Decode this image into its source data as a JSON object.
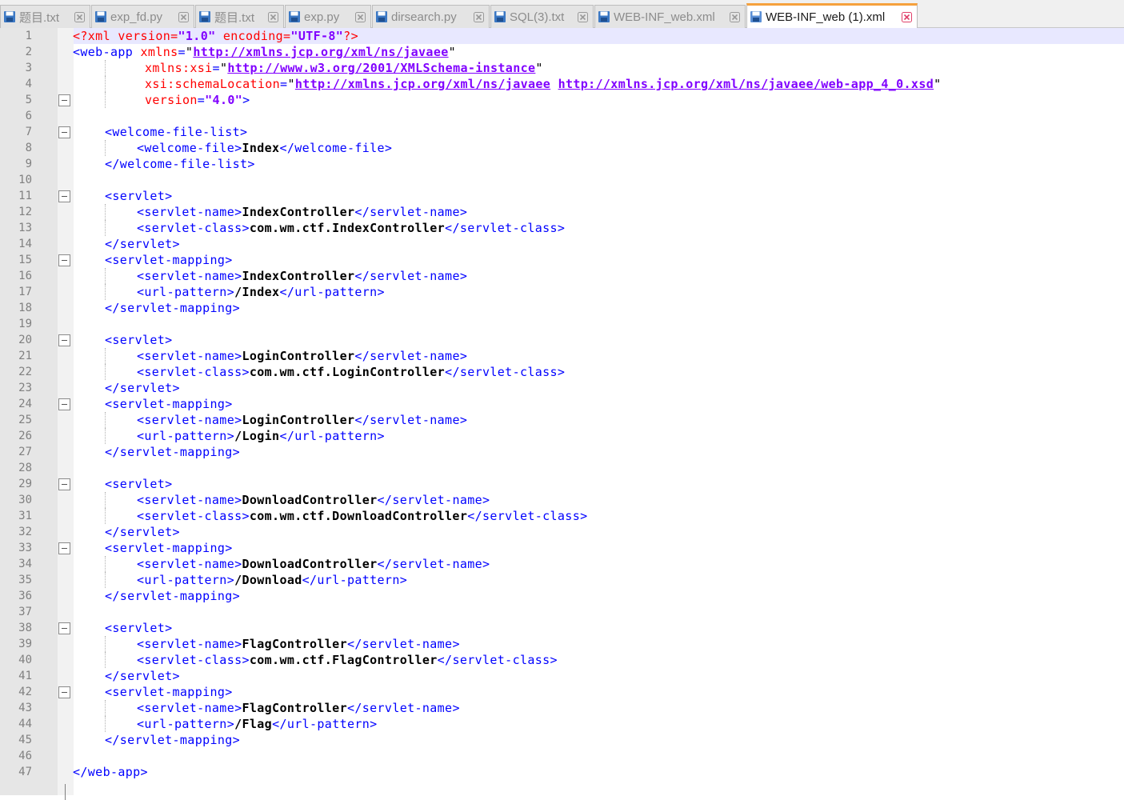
{
  "tabs": [
    {
      "label": "题目.txt",
      "active": false
    },
    {
      "label": "exp_fd.py",
      "active": false
    },
    {
      "label": "题目.txt",
      "active": false
    },
    {
      "label": "exp.py",
      "active": false
    },
    {
      "label": "dirsearch.py",
      "active": false
    },
    {
      "label": "SQL(3).txt",
      "active": false
    },
    {
      "label": "WEB-INF_web.xml",
      "active": false
    },
    {
      "label": "WEB-INF_web (1).xml",
      "active": true
    }
  ],
  "icons": {
    "tab_save": "floppy-save-icon",
    "tab_close": "close-icon",
    "fold": "fold-minus-icon"
  },
  "colors": {
    "tag": "#0000ff",
    "attr": "#ff0000",
    "string": "#8000ff",
    "text": "#000000",
    "active_tab_accent": "#f5a13c",
    "current_line": "#e8e8ff"
  },
  "editor": {
    "current_line": 1,
    "fold_lines": [
      5,
      7,
      11,
      15,
      20,
      24,
      29,
      33,
      38,
      42
    ],
    "lines": [
      {
        "n": "1",
        "indent": 0,
        "parts": [
          [
            "pi",
            "<?xml "
          ],
          [
            "attr",
            "version"
          ],
          [
            "pi",
            "="
          ],
          [
            "str",
            "\"1.0\""
          ],
          [
            "pi",
            " encoding"
          ],
          [
            "pi",
            "="
          ],
          [
            "str",
            "\"UTF-8\""
          ],
          [
            "pi",
            "?>"
          ]
        ]
      },
      {
        "n": "2",
        "indent": 0,
        "parts": [
          [
            "tag",
            "<web-app "
          ],
          [
            "attr",
            "xmlns"
          ],
          [
            "tag",
            "="
          ],
          [
            "quote",
            "\""
          ],
          [
            "url",
            "http://xmlns.jcp.org/xml/ns/javaee"
          ],
          [
            "quote",
            "\""
          ]
        ]
      },
      {
        "n": "3",
        "indent": 9,
        "parts": [
          [
            "attr",
            "xmlns:xsi"
          ],
          [
            "tag",
            "="
          ],
          [
            "quote",
            "\""
          ],
          [
            "url",
            "http://www.w3.org/2001/XMLSchema-instance"
          ],
          [
            "quote",
            "\""
          ]
        ]
      },
      {
        "n": "4",
        "indent": 9,
        "parts": [
          [
            "attr",
            "xsi:schemaLocation"
          ],
          [
            "tag",
            "="
          ],
          [
            "quote",
            "\""
          ],
          [
            "url",
            "http://xmlns.jcp.org/xml/ns/javaee"
          ],
          [
            "tag",
            " "
          ],
          [
            "url",
            "http://xmlns.jcp.org/xml/ns/javaee/web-app_4_0.xsd"
          ],
          [
            "quote",
            "\""
          ]
        ]
      },
      {
        "n": "5",
        "indent": 9,
        "parts": [
          [
            "attr",
            "version"
          ],
          [
            "tag",
            "="
          ],
          [
            "str",
            "\"4.0\""
          ],
          [
            "tag",
            ">"
          ]
        ]
      },
      {
        "n": "6",
        "indent": 0,
        "parts": []
      },
      {
        "n": "7",
        "indent": 4,
        "parts": [
          [
            "tag",
            "<welcome-file-list>"
          ]
        ]
      },
      {
        "n": "8",
        "indent": 8,
        "parts": [
          [
            "tag",
            "<welcome-file>"
          ],
          [
            "txt",
            "Index"
          ],
          [
            "tag",
            "</welcome-file>"
          ]
        ]
      },
      {
        "n": "9",
        "indent": 4,
        "parts": [
          [
            "tag",
            "</welcome-file-list>"
          ]
        ]
      },
      {
        "n": "10",
        "indent": 0,
        "parts": []
      },
      {
        "n": "11",
        "indent": 4,
        "parts": [
          [
            "tag",
            "<servlet>"
          ]
        ]
      },
      {
        "n": "12",
        "indent": 8,
        "parts": [
          [
            "tag",
            "<servlet-name>"
          ],
          [
            "txt",
            "IndexController"
          ],
          [
            "tag",
            "</servlet-name>"
          ]
        ]
      },
      {
        "n": "13",
        "indent": 8,
        "parts": [
          [
            "tag",
            "<servlet-class>"
          ],
          [
            "txt",
            "com.wm.ctf.IndexController"
          ],
          [
            "tag",
            "</servlet-class>"
          ]
        ]
      },
      {
        "n": "14",
        "indent": 4,
        "parts": [
          [
            "tag",
            "</servlet>"
          ]
        ]
      },
      {
        "n": "15",
        "indent": 4,
        "parts": [
          [
            "tag",
            "<servlet-mapping>"
          ]
        ]
      },
      {
        "n": "16",
        "indent": 8,
        "parts": [
          [
            "tag",
            "<servlet-name>"
          ],
          [
            "txt",
            "IndexController"
          ],
          [
            "tag",
            "</servlet-name>"
          ]
        ]
      },
      {
        "n": "17",
        "indent": 8,
        "parts": [
          [
            "tag",
            "<url-pattern>"
          ],
          [
            "txt",
            "/Index"
          ],
          [
            "tag",
            "</url-pattern>"
          ]
        ]
      },
      {
        "n": "18",
        "indent": 4,
        "parts": [
          [
            "tag",
            "</servlet-mapping>"
          ]
        ]
      },
      {
        "n": "19",
        "indent": 0,
        "parts": []
      },
      {
        "n": "20",
        "indent": 4,
        "parts": [
          [
            "tag",
            "<servlet>"
          ]
        ]
      },
      {
        "n": "21",
        "indent": 8,
        "parts": [
          [
            "tag",
            "<servlet-name>"
          ],
          [
            "txt",
            "LoginController"
          ],
          [
            "tag",
            "</servlet-name>"
          ]
        ]
      },
      {
        "n": "22",
        "indent": 8,
        "parts": [
          [
            "tag",
            "<servlet-class>"
          ],
          [
            "txt",
            "com.wm.ctf.LoginController"
          ],
          [
            "tag",
            "</servlet-class>"
          ]
        ]
      },
      {
        "n": "23",
        "indent": 4,
        "parts": [
          [
            "tag",
            "</servlet>"
          ]
        ]
      },
      {
        "n": "24",
        "indent": 4,
        "parts": [
          [
            "tag",
            "<servlet-mapping>"
          ]
        ]
      },
      {
        "n": "25",
        "indent": 8,
        "parts": [
          [
            "tag",
            "<servlet-name>"
          ],
          [
            "txt",
            "LoginController"
          ],
          [
            "tag",
            "</servlet-name>"
          ]
        ]
      },
      {
        "n": "26",
        "indent": 8,
        "parts": [
          [
            "tag",
            "<url-pattern>"
          ],
          [
            "txt",
            "/Login"
          ],
          [
            "tag",
            "</url-pattern>"
          ]
        ]
      },
      {
        "n": "27",
        "indent": 4,
        "parts": [
          [
            "tag",
            "</servlet-mapping>"
          ]
        ]
      },
      {
        "n": "28",
        "indent": 0,
        "parts": []
      },
      {
        "n": "29",
        "indent": 4,
        "parts": [
          [
            "tag",
            "<servlet>"
          ]
        ]
      },
      {
        "n": "30",
        "indent": 8,
        "parts": [
          [
            "tag",
            "<servlet-name>"
          ],
          [
            "txt",
            "DownloadController"
          ],
          [
            "tag",
            "</servlet-name>"
          ]
        ]
      },
      {
        "n": "31",
        "indent": 8,
        "parts": [
          [
            "tag",
            "<servlet-class>"
          ],
          [
            "txt",
            "com.wm.ctf.DownloadController"
          ],
          [
            "tag",
            "</servlet-class>"
          ]
        ]
      },
      {
        "n": "32",
        "indent": 4,
        "parts": [
          [
            "tag",
            "</servlet>"
          ]
        ]
      },
      {
        "n": "33",
        "indent": 4,
        "parts": [
          [
            "tag",
            "<servlet-mapping>"
          ]
        ]
      },
      {
        "n": "34",
        "indent": 8,
        "parts": [
          [
            "tag",
            "<servlet-name>"
          ],
          [
            "txt",
            "DownloadController"
          ],
          [
            "tag",
            "</servlet-name>"
          ]
        ]
      },
      {
        "n": "35",
        "indent": 8,
        "parts": [
          [
            "tag",
            "<url-pattern>"
          ],
          [
            "txt",
            "/Download"
          ],
          [
            "tag",
            "</url-pattern>"
          ]
        ]
      },
      {
        "n": "36",
        "indent": 4,
        "parts": [
          [
            "tag",
            "</servlet-mapping>"
          ]
        ]
      },
      {
        "n": "37",
        "indent": 0,
        "parts": []
      },
      {
        "n": "38",
        "indent": 4,
        "parts": [
          [
            "tag",
            "<servlet>"
          ]
        ]
      },
      {
        "n": "39",
        "indent": 8,
        "parts": [
          [
            "tag",
            "<servlet-name>"
          ],
          [
            "txt",
            "FlagController"
          ],
          [
            "tag",
            "</servlet-name>"
          ]
        ]
      },
      {
        "n": "40",
        "indent": 8,
        "parts": [
          [
            "tag",
            "<servlet-class>"
          ],
          [
            "txt",
            "com.wm.ctf.FlagController"
          ],
          [
            "tag",
            "</servlet-class>"
          ]
        ]
      },
      {
        "n": "41",
        "indent": 4,
        "parts": [
          [
            "tag",
            "</servlet>"
          ]
        ]
      },
      {
        "n": "42",
        "indent": 4,
        "parts": [
          [
            "tag",
            "<servlet-mapping>"
          ]
        ]
      },
      {
        "n": "43",
        "indent": 8,
        "parts": [
          [
            "tag",
            "<servlet-name>"
          ],
          [
            "txt",
            "FlagController"
          ],
          [
            "tag",
            "</servlet-name>"
          ]
        ]
      },
      {
        "n": "44",
        "indent": 8,
        "parts": [
          [
            "tag",
            "<url-pattern>"
          ],
          [
            "txt",
            "/Flag"
          ],
          [
            "tag",
            "</url-pattern>"
          ]
        ]
      },
      {
        "n": "45",
        "indent": 4,
        "parts": [
          [
            "tag",
            "</servlet-mapping>"
          ]
        ]
      },
      {
        "n": "46",
        "indent": 0,
        "parts": []
      },
      {
        "n": "47",
        "indent": 0,
        "parts": [
          [
            "tag",
            "</web-app>"
          ]
        ]
      }
    ]
  }
}
